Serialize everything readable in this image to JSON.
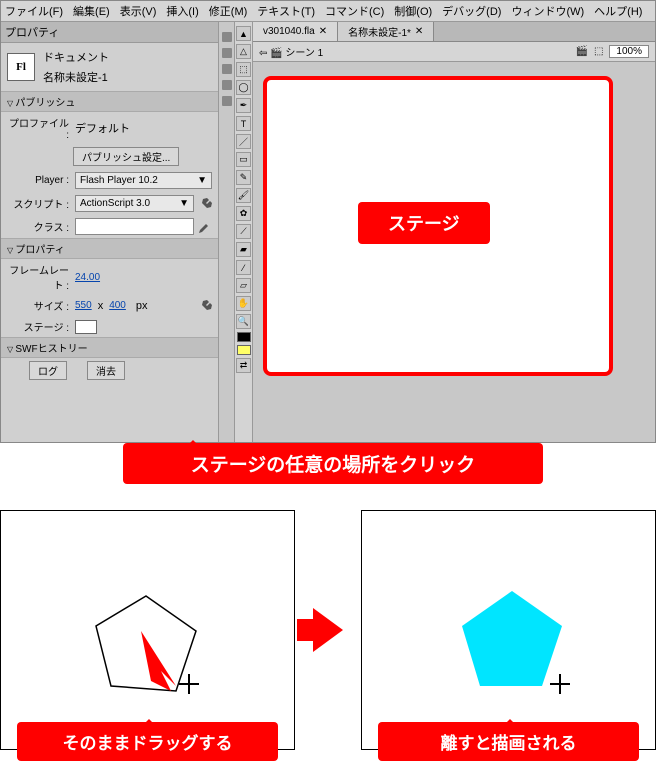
{
  "menu": [
    "ファイル(F)",
    "編集(E)",
    "表示(V)",
    "挿入(I)",
    "修正(M)",
    "テキスト(T)",
    "コマンド(C)",
    "制御(O)",
    "デバッグ(D)",
    "ウィンドウ(W)",
    "ヘルプ(H)"
  ],
  "panel": {
    "tab": "プロパティ",
    "doc_type": "ドキュメント",
    "doc_name": "名称未設定-1",
    "sections": {
      "publish": "パブリッシュ",
      "properties": "プロパティ",
      "history": "SWFヒストリー"
    },
    "labels": {
      "profile": "プロファイル :",
      "player": "Player :",
      "script": "スクリプト :",
      "class": "クラス :",
      "fps": "フレームレート :",
      "size": "サイズ :",
      "stage": "ステージ :"
    },
    "values": {
      "profile": "デフォルト",
      "publish_btn": "パブリッシュ設定...",
      "player": "Flash Player 10.2",
      "script": "ActionScript 3.0",
      "class": "",
      "fps": "24.00",
      "width": "550",
      "height": "400",
      "unit": "px",
      "x": "x"
    },
    "buttons": {
      "log": "ログ",
      "clear": "消去"
    }
  },
  "canvas": {
    "tabs": [
      "v301040.fla",
      "名称未設定-1*"
    ],
    "scene_prefix": "⇦",
    "scene": "シーン 1",
    "zoom": "100%",
    "stage_label": "ステージ"
  },
  "callouts": {
    "main": "ステージの任意の場所をクリック",
    "step1": "そのままドラッグする",
    "step2": "離すと描画される"
  }
}
